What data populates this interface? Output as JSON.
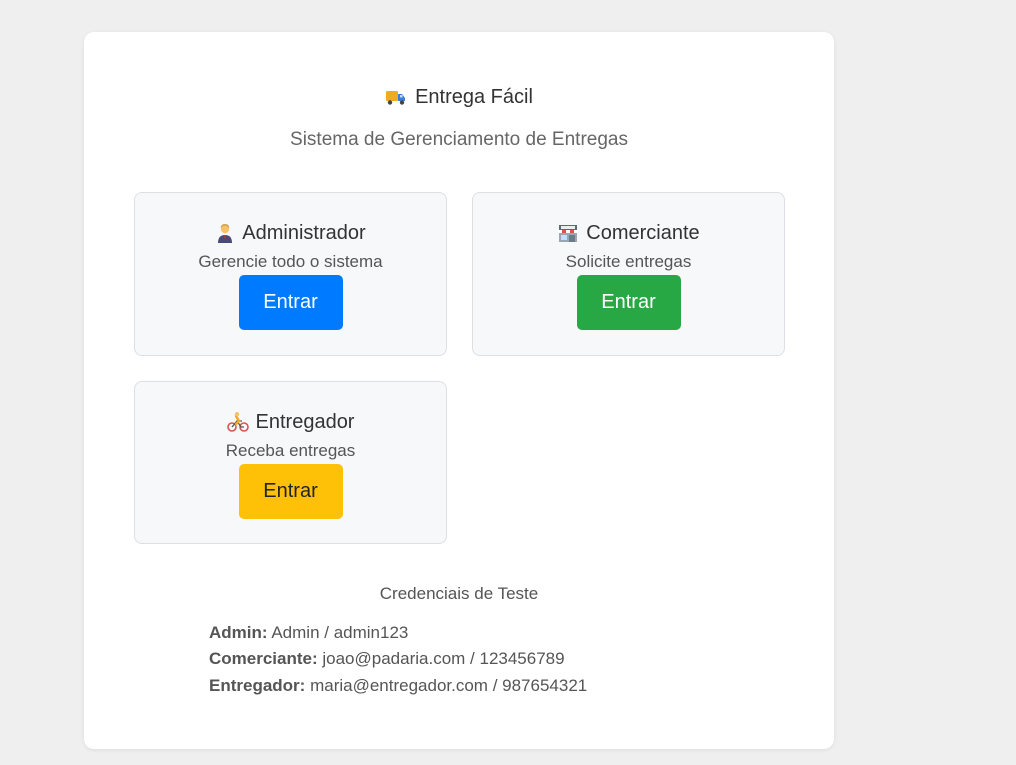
{
  "header": {
    "title": "Entrega Fácil",
    "subtitle": "Sistema de Gerenciamento de Entregas",
    "icon": "delivery-truck-icon"
  },
  "roles": [
    {
      "name": "Administrador",
      "description": "Gerencie todo o sistema",
      "button_label": "Entrar",
      "button_color": "#007bff",
      "button_text_color": "#ffffff",
      "icon": "admin-person-icon"
    },
    {
      "name": "Comerciante",
      "description": "Solicite entregas",
      "button_label": "Entrar",
      "button_color": "#28a745",
      "button_text_color": "#ffffff",
      "icon": "store-icon"
    },
    {
      "name": "Entregador",
      "description": "Receba entregas",
      "button_label": "Entrar",
      "button_color": "#ffc107",
      "button_text_color": "#212529",
      "icon": "cyclist-icon"
    }
  ],
  "credentials": {
    "title": "Credenciais de Teste",
    "lines": [
      {
        "label": "Admin:",
        "value": "Admin / admin123"
      },
      {
        "label": "Comerciante:",
        "value": "joao@padaria.com / 123456789"
      },
      {
        "label": "Entregador:",
        "value": "maria@entregador.com / 987654321"
      }
    ]
  }
}
